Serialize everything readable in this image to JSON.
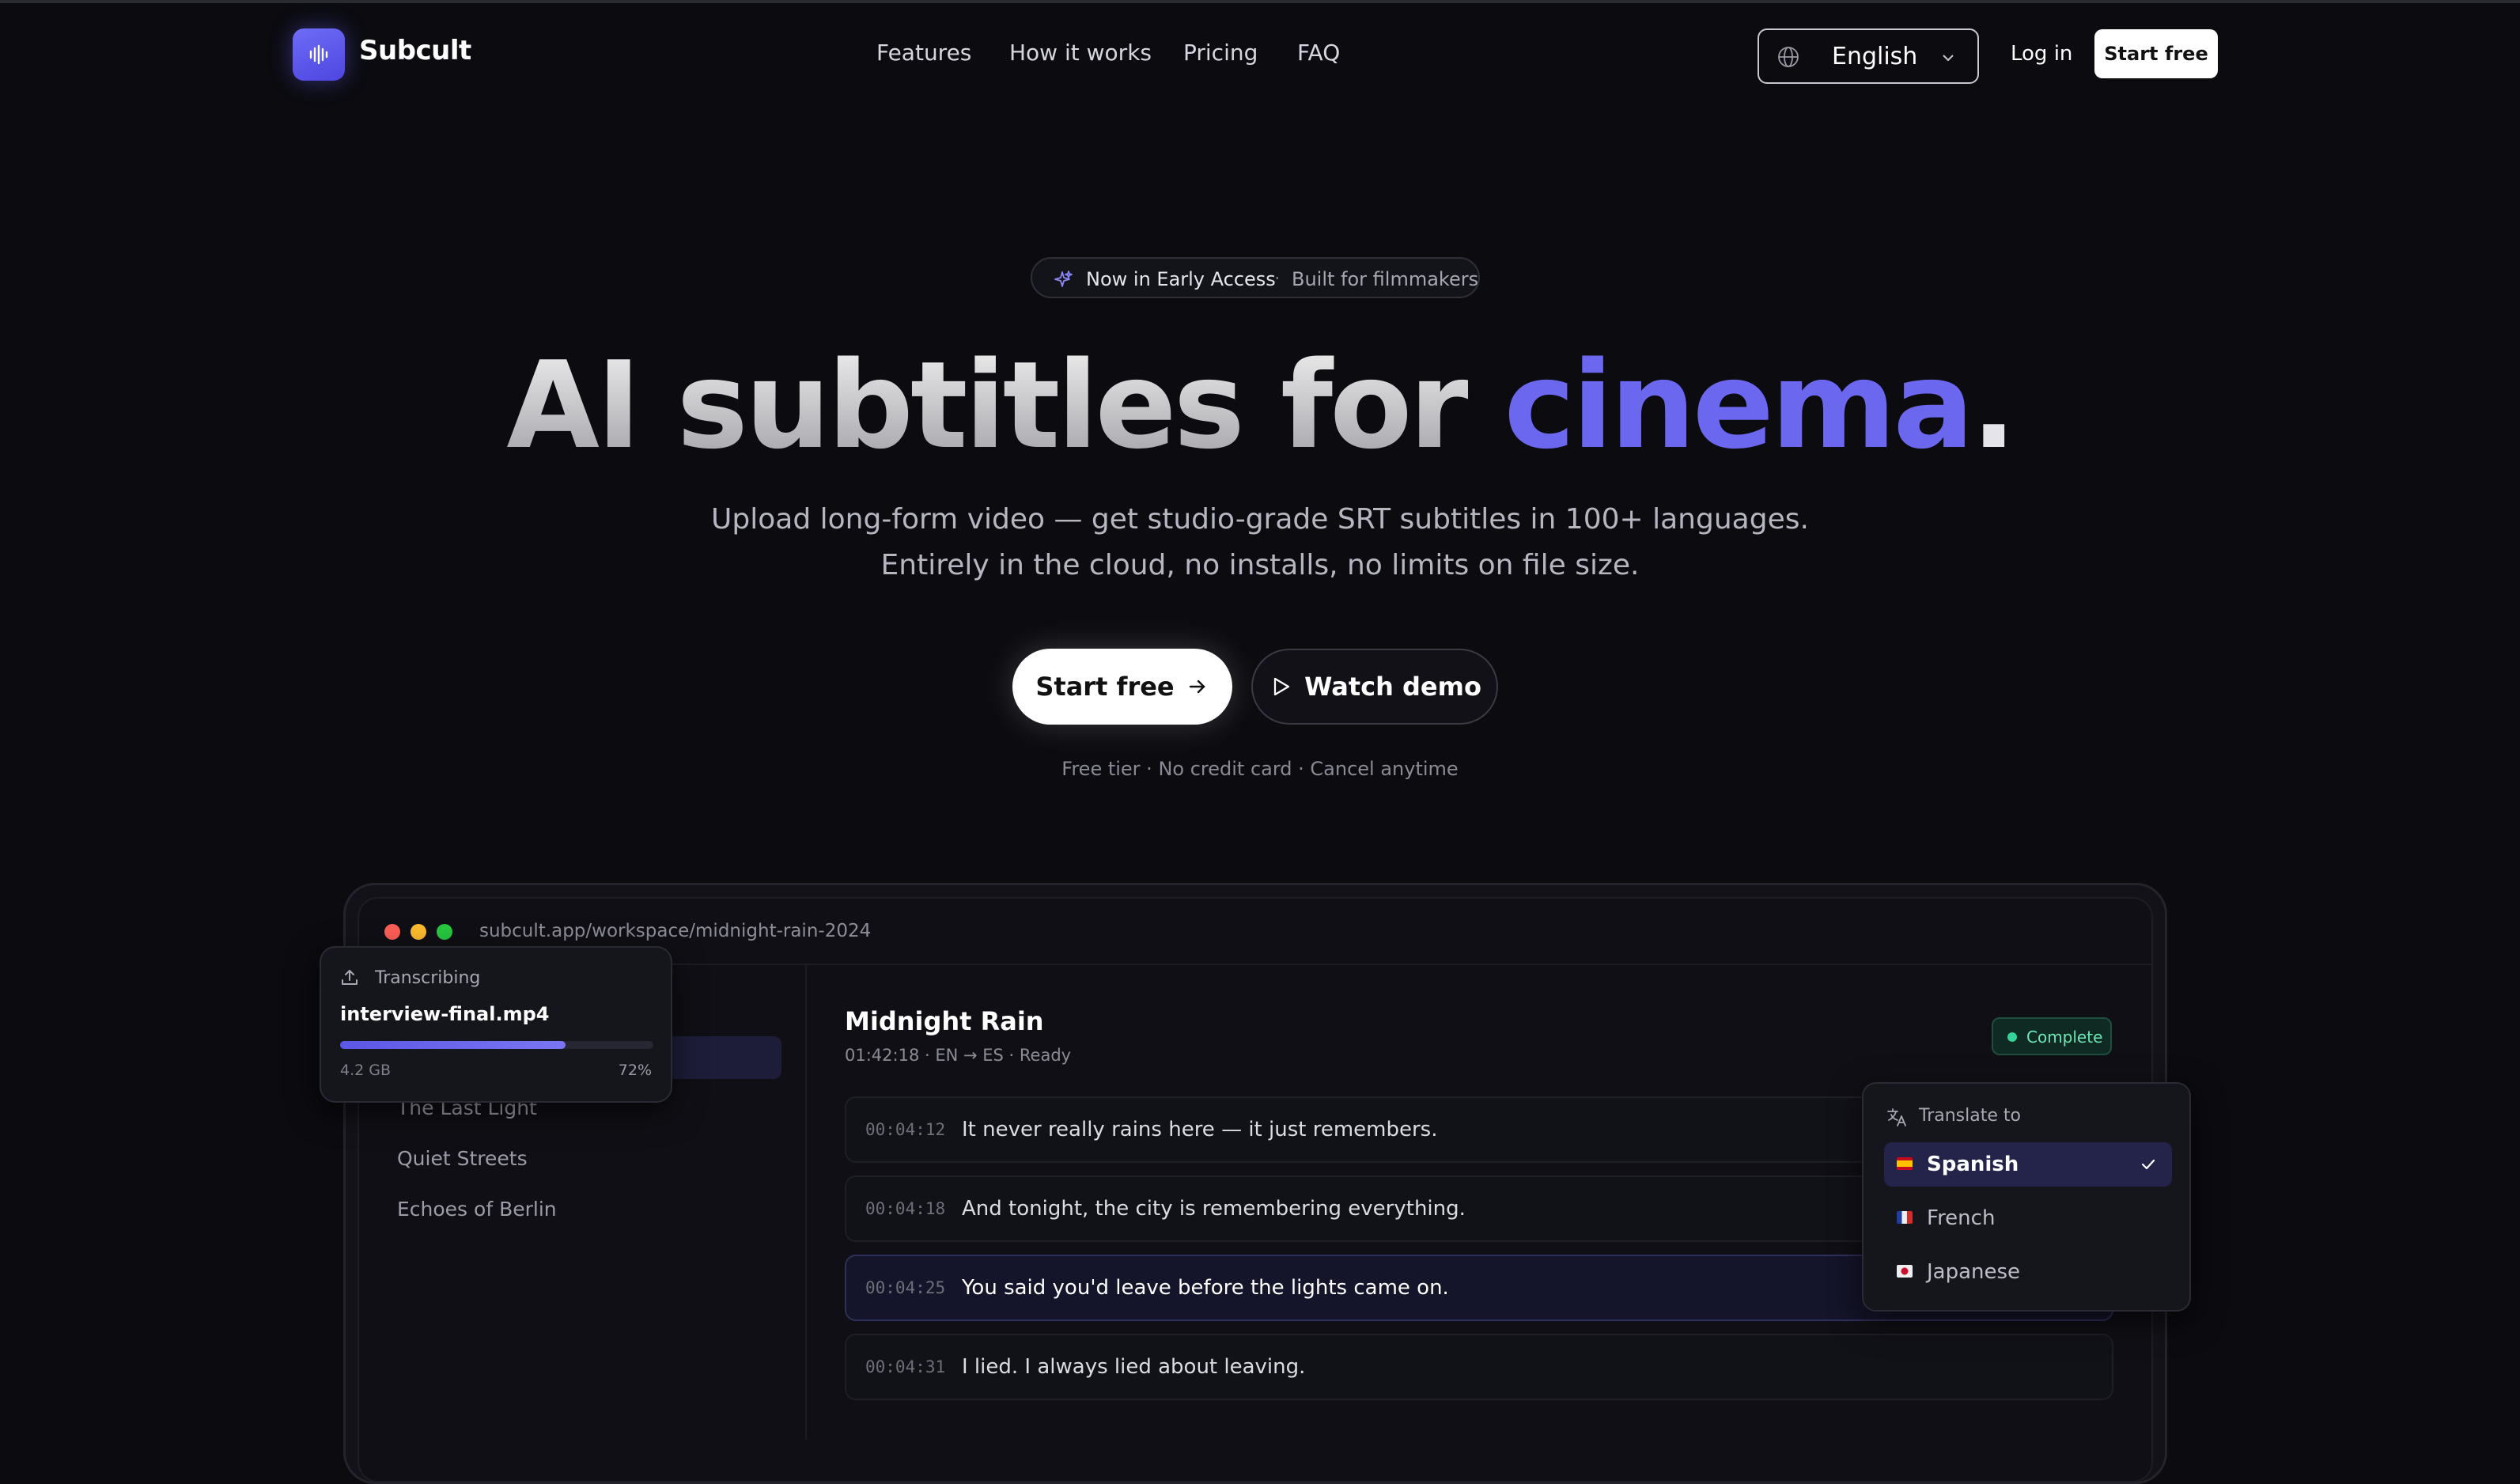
{
  "header": {
    "brand": "Subcult",
    "nav": [
      "Features",
      "How it works",
      "Pricing",
      "FAQ"
    ],
    "language": "English",
    "login": "Log in",
    "start": "Start free"
  },
  "hero": {
    "pill_primary": "Now in Early Access",
    "pill_separator": "·",
    "pill_secondary": "Built for filmmakers",
    "headline_plain": "AI subtitles for ",
    "headline_accent": "cinema",
    "headline_period": ".",
    "sub_line1": "Upload long-form video — get studio-grade SRT subtitles in 100+ languages.",
    "sub_line2": "Entirely in the cloud, no installs, no limits on file size.",
    "cta_start": "Start free",
    "cta_demo": "Watch demo",
    "fineprint": "Free tier · No credit card · Cancel anytime"
  },
  "app": {
    "url": "subcult.app/workspace/midnight-rain-2024",
    "sidebar": [
      "The Last Light",
      "Quiet Streets",
      "Echoes of Berlin"
    ],
    "project": {
      "title": "Midnight Rain",
      "meta": "01:42:18 · EN → ES · Ready",
      "status": "Complete"
    },
    "lines": [
      {
        "time": "00:04:12",
        "text": "It never really rains here — it just remembers."
      },
      {
        "time": "00:04:18",
        "text": "And tonight, the city is remembering everything."
      },
      {
        "time": "00:04:25",
        "text": "You said you'd leave before the lights came on."
      },
      {
        "time": "00:04:31",
        "text": "I lied. I always lied about leaving."
      }
    ],
    "transcribing": {
      "label": "Transcribing",
      "filename": "interview-final.mp4",
      "size": "4.2 GB",
      "percent": "72%",
      "progress": 0.72
    },
    "translate": {
      "heading": "Translate to",
      "options": [
        "Spanish",
        "French",
        "Japanese"
      ],
      "selected": "Spanish"
    }
  },
  "colors": {
    "background": "#0b0b10",
    "accent": "#6b67ef",
    "status_green": "#34d399"
  }
}
